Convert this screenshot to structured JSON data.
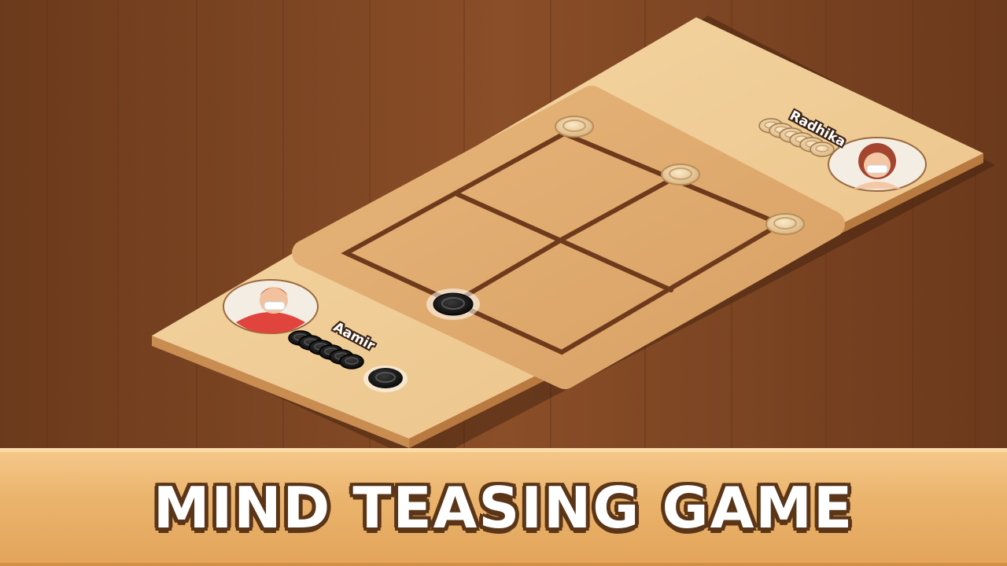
{
  "players": {
    "bottom": {
      "name": "Aamir",
      "piece_color": "black",
      "pieces_in_reserve": 6
    },
    "top": {
      "name": "Radhika",
      "piece_color": "white",
      "pieces_in_reserve": 6
    }
  },
  "board": {
    "white_pieces_on_board": 3,
    "black_pieces_on_board": 1
  },
  "selected_piece": {
    "color": "black"
  },
  "banner": {
    "title": "MIND TEASING GAME"
  },
  "colors": {
    "table": "#7a4322",
    "board_surface": "#f0c98e",
    "board_lines": "#6e3a1c",
    "banner": "#eab36c",
    "title_outline": "#5a3518"
  }
}
